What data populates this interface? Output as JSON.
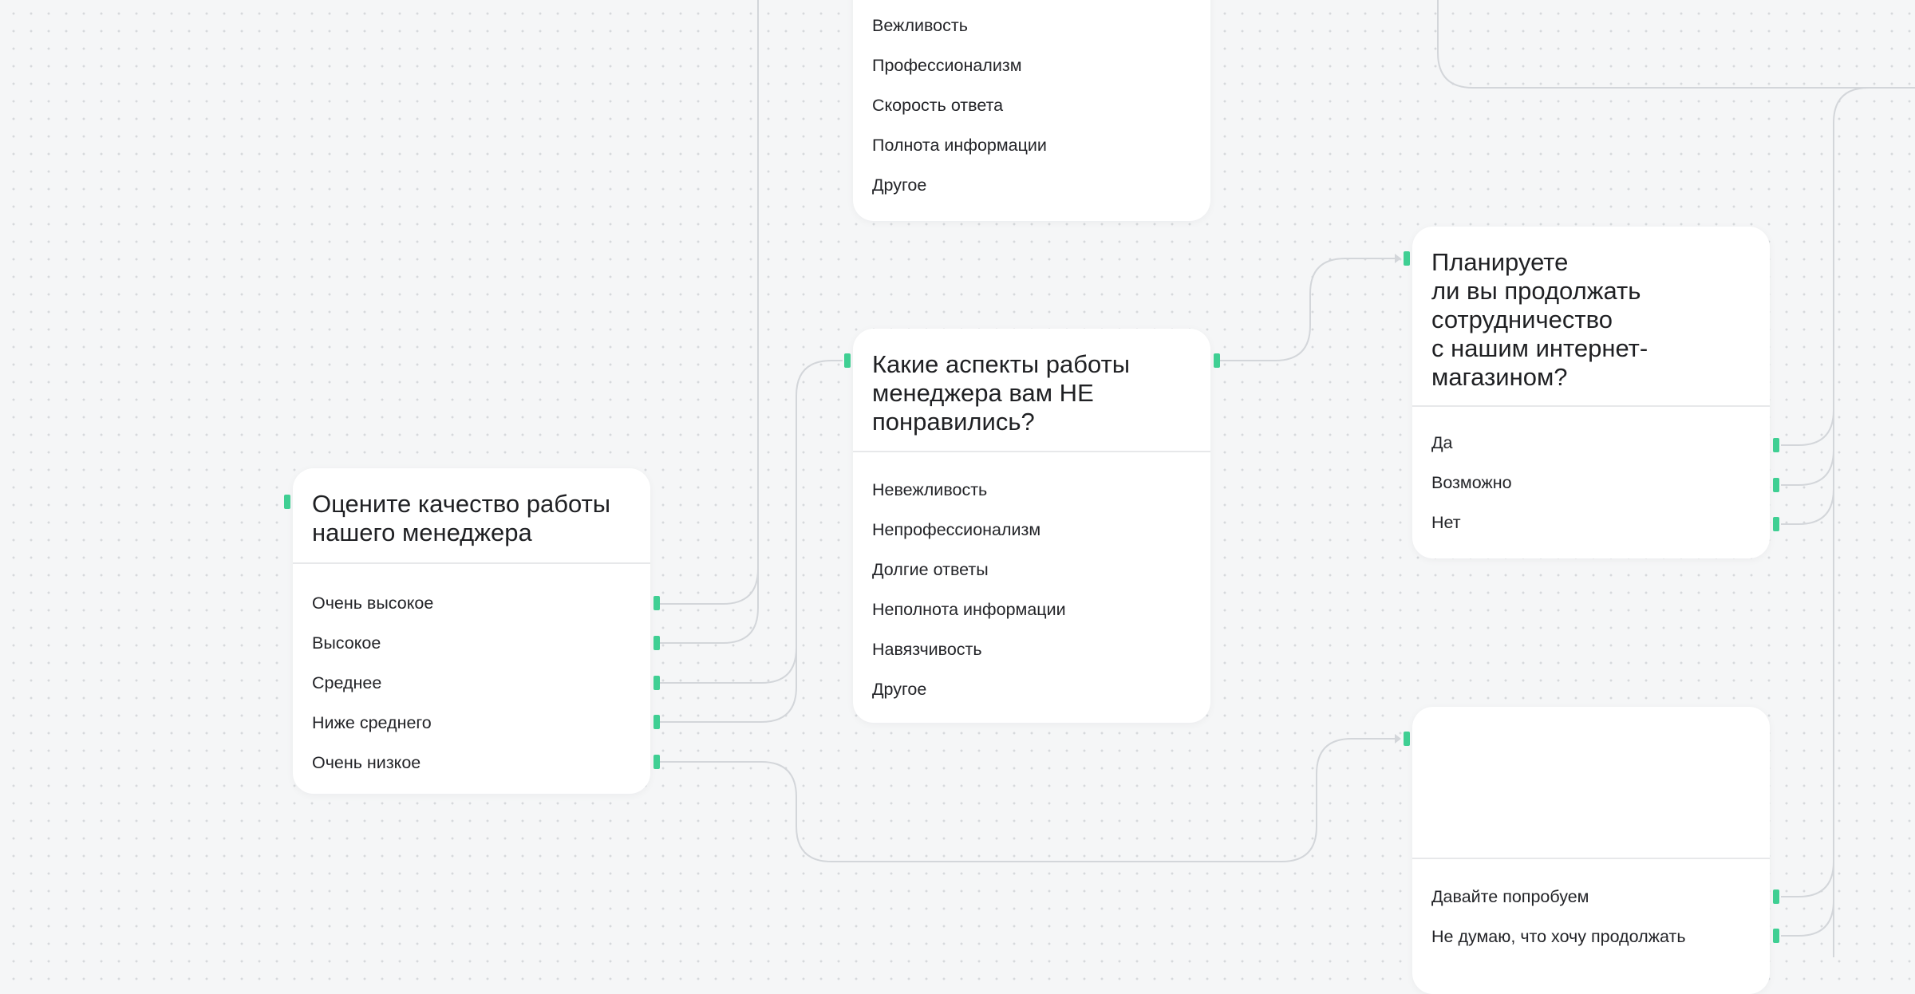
{
  "nodes": {
    "top": {
      "title": "",
      "options": [
        "Вежливость",
        "Профессионализм",
        "Скорость ответа",
        "Полнота информации",
        "Другое"
      ]
    },
    "rate": {
      "title": "Оцените качество работы\nнашего менеджера",
      "options": [
        "Очень высокое",
        "Высокое",
        "Среднее",
        "Ниже среднего",
        "Очень низкое"
      ]
    },
    "dislike": {
      "title": "Какие аспекты работы\nменеджера вам НЕ\nпонравились?",
      "options": [
        "Невежливость",
        "Непрофессионализм",
        "Долгие ответы",
        "Неполнота информации",
        "Навязчивость",
        "Другое"
      ]
    },
    "plan": {
      "title": "Планируете\nли вы продолжать\nсотрудничество\nс нашим интернет-\nмагазином?",
      "options": [
        "Да",
        "Возможно",
        "Нет"
      ]
    },
    "retry": {
      "title": "",
      "options": [
        "Давайте попробуем",
        "Не думаю, что хочу продолжать"
      ]
    }
  },
  "colors": {
    "canvas": "#f5f6f7",
    "card": "#ffffff",
    "handle": "#3fcf93",
    "connector": "#d3d6da"
  }
}
